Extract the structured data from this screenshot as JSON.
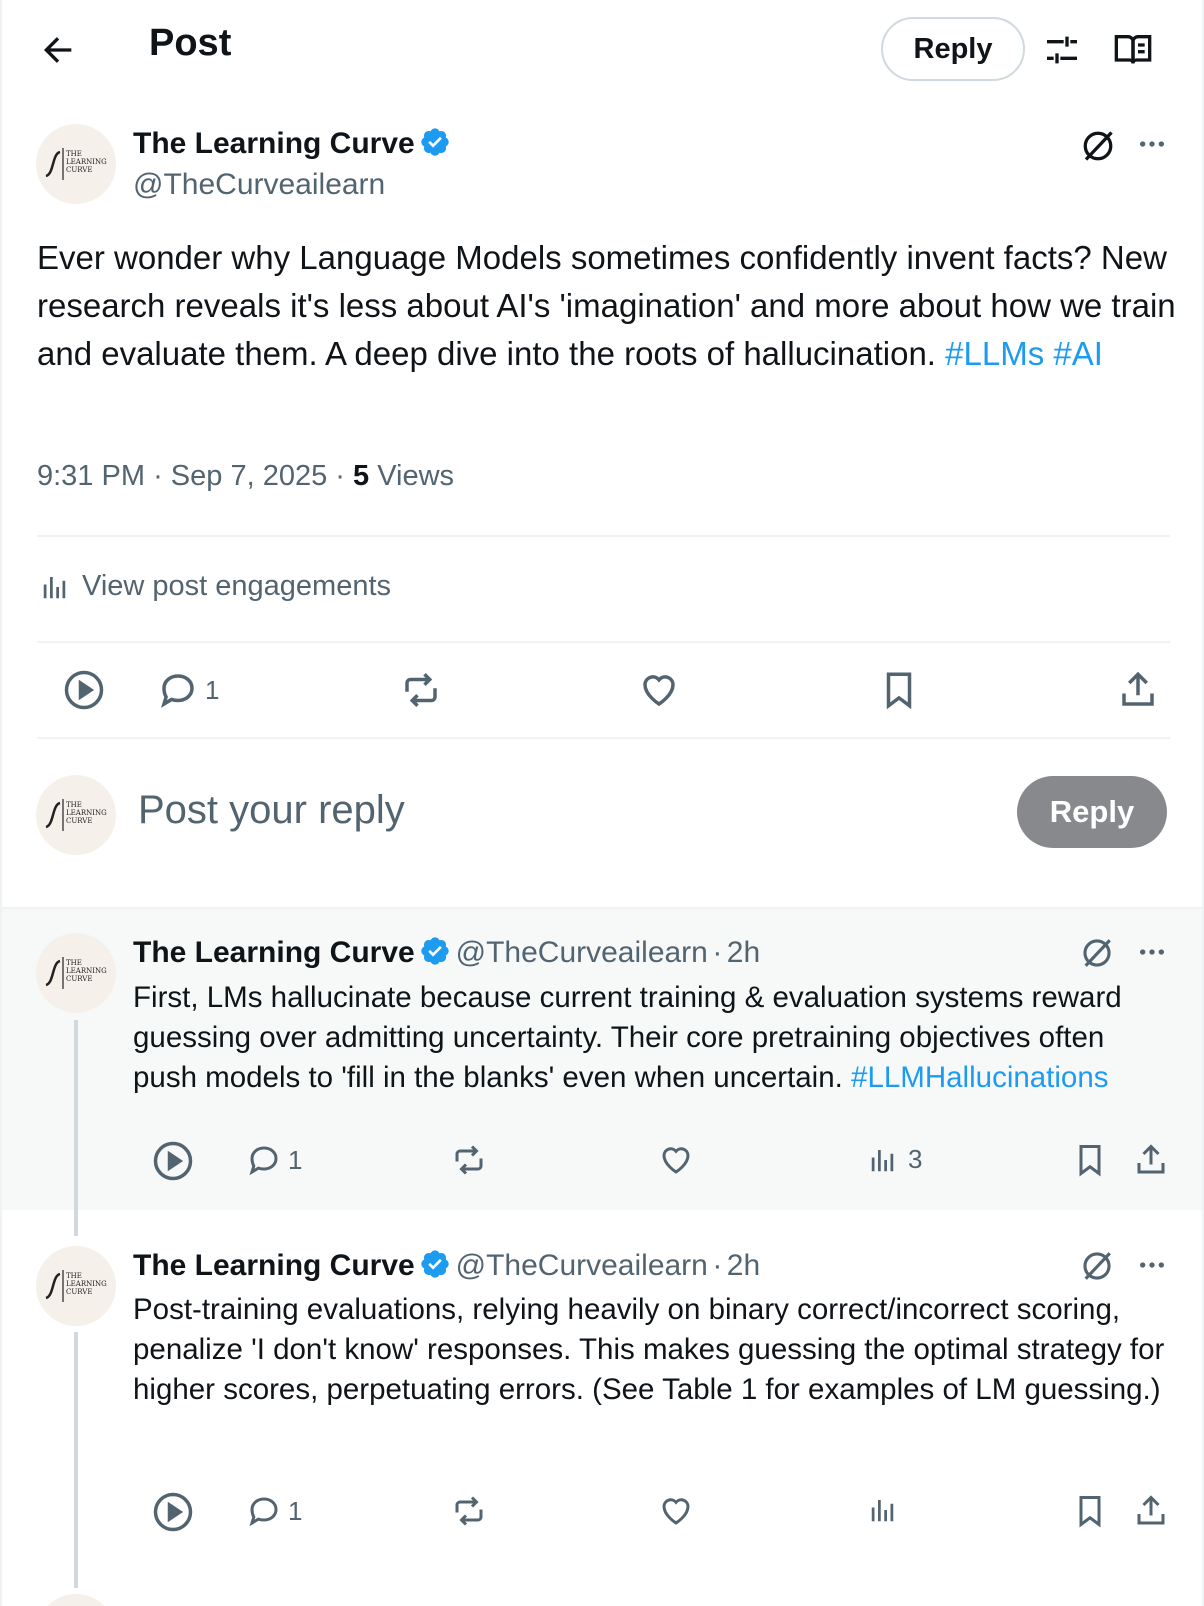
{
  "header": {
    "title": "Post",
    "reply_label": "Reply",
    "icons": [
      "back-arrow-icon",
      "tune-icon",
      "reader-icon"
    ]
  },
  "post": {
    "author": "The Learning Curve",
    "handle": "@TheCurveailearn",
    "avatar_text": [
      "THE",
      "LEARNING",
      "CURVE"
    ],
    "text": "Ever wonder why Language Models sometimes confidently invent facts? New research reveals it's less about AI's 'imagination' and more about how we train and evaluate them. A deep dive into the roots of hallucination.",
    "hashtags": [
      "#LLMs",
      "#AI"
    ],
    "time": "9:31 PM",
    "date": "Sep 7, 2025",
    "separator": "·",
    "views_count": "5",
    "views_label": "Views",
    "engagements_label": "View post engagements",
    "reply_count": "1"
  },
  "compose": {
    "placeholder": "Post your reply",
    "button_label": "Reply"
  },
  "replies": [
    {
      "author": "The Learning Curve",
      "handle": "@TheCurveailearn",
      "age": "2h",
      "text": "First, LMs hallucinate because current training & evaluation systems reward guessing over admitting uncertainty. Their core pretraining objectives often push models to 'fill in the blanks' even when uncertain.",
      "hashtag": "#LLMHallucinations",
      "reply_count": "1",
      "views_count": "3"
    },
    {
      "author": "The Learning Curve",
      "handle": "@TheCurveailearn",
      "age": "2h",
      "text": "Post-training evaluations, relying heavily on binary correct/incorrect scoring, penalize 'I don't know' responses. This makes guessing the optimal strategy for higher scores, perpetuating errors. (See Table 1 for examples of LM guessing.)",
      "hashtag": "",
      "reply_count": "1",
      "views_count": ""
    }
  ],
  "colors": {
    "accent": "#1d9bf0",
    "text": "#0f1419",
    "muted": "#536471",
    "reply_button_disabled": "#87898c"
  }
}
